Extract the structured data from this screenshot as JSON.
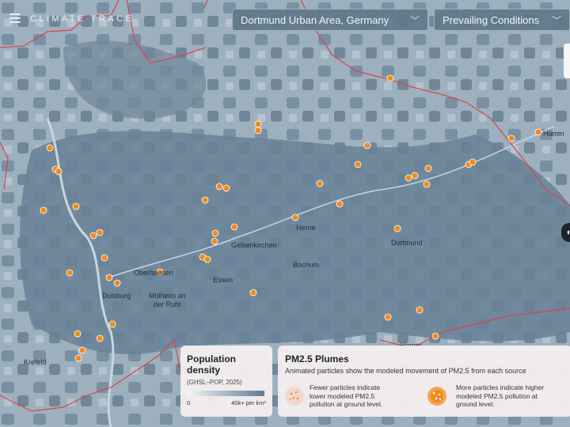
{
  "header": {
    "logo": "CLIMATE TRACE",
    "region_select": "Dortmund Urban Area, Germany",
    "layer_select": "Prevailing Conditions"
  },
  "map": {
    "places": [
      {
        "name": "Hamm"
      },
      {
        "name": "Herne"
      },
      {
        "name": "Gelsenkirchen"
      },
      {
        "name": "Dortmund"
      },
      {
        "name": "Bochum"
      },
      {
        "name": "Oberhausen"
      },
      {
        "name": "Essen"
      },
      {
        "name": "Duisburg"
      },
      {
        "name": "Mülheim an"
      },
      {
        "name": "der Ruhr"
      },
      {
        "name": "Krefeld"
      },
      {
        "name": "Hagen"
      }
    ]
  },
  "population_legend": {
    "title": "Population density",
    "subtitle": "(GHSL–POP, 2025)",
    "min": "0",
    "max": "40k+ per km²"
  },
  "plumes_legend": {
    "title": "PM2.5 Plumes",
    "description": "Animated particles show the modeled movement of PM2.5 from each source",
    "fewer_line1": "Fewer particles indicate",
    "fewer_line2": "lower modeled PM2.5",
    "fewer_line3": "pollution at ground level.",
    "more_line1": "More particles indicate higher",
    "more_line2": "modeled PM2.5 pollution at",
    "more_line3": "ground level."
  },
  "colors": {
    "source_marker": "#f28a1c",
    "boundary": "#d8444a",
    "density_dark": "#5f7c91"
  }
}
